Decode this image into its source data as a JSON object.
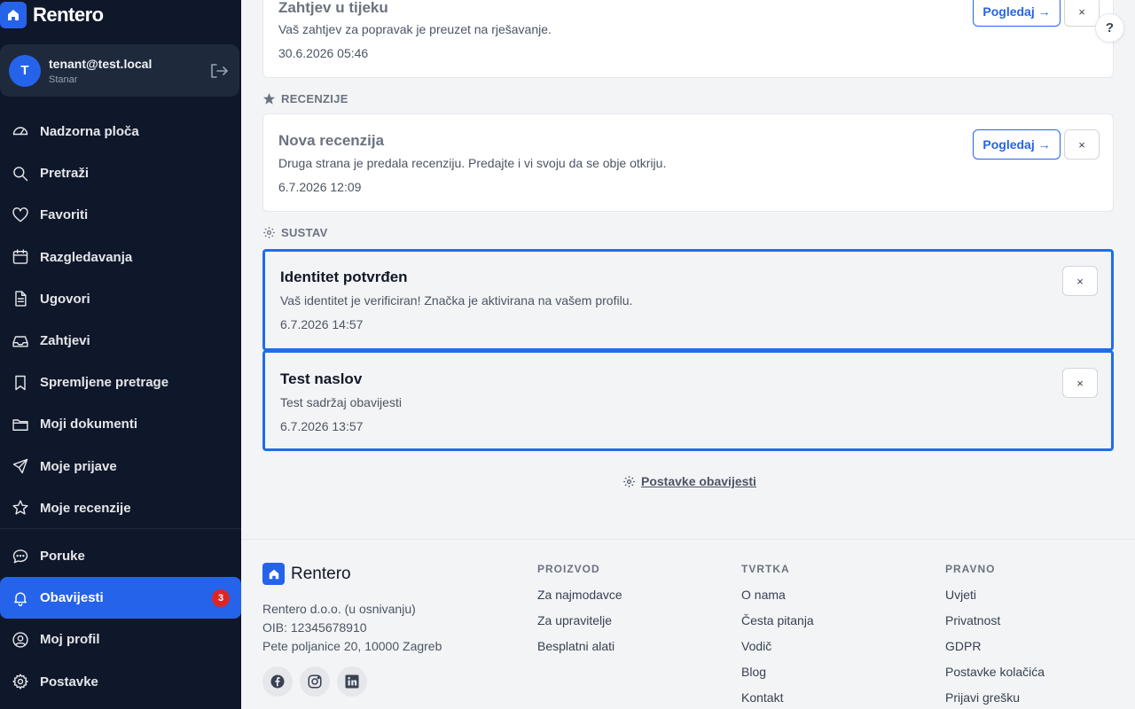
{
  "brand": {
    "name": "Rentero"
  },
  "user": {
    "initial": "T",
    "email": "tenant@test.local",
    "role": "Stanar"
  },
  "nav": [
    {
      "label": "Nadzorna ploča",
      "icon": "dashboard-icon"
    },
    {
      "label": "Pretraži",
      "icon": "search-icon"
    },
    {
      "label": "Favoriti",
      "icon": "heart-icon"
    },
    {
      "label": "Razgledavanja",
      "icon": "calendar-icon"
    },
    {
      "label": "Ugovori",
      "icon": "document-icon"
    },
    {
      "label": "Zahtjevi",
      "icon": "inbox-icon"
    },
    {
      "label": "Spremljene pretrage",
      "icon": "bookmark-icon"
    },
    {
      "label": "Moji dokumenti",
      "icon": "folder-icon"
    },
    {
      "label": "Moje prijave",
      "icon": "send-icon"
    },
    {
      "label": "Moje recenzije",
      "icon": "star-icon"
    }
  ],
  "nav2": [
    {
      "label": "Poruke",
      "icon": "chat-icon"
    },
    {
      "label": "Obavijesti",
      "icon": "bell-icon",
      "badge": "3",
      "active": true
    },
    {
      "label": "Moj profil",
      "icon": "user-circle-icon"
    },
    {
      "label": "Postavke",
      "icon": "gear-icon"
    }
  ],
  "help": "?",
  "notifications": {
    "top_card": {
      "title": "Zahtjev u tijeku",
      "body": "Vaš zahtjev za popravak je preuzet na rješavanje.",
      "time": "30.6.2026 05:46",
      "view": "Pogledaj →",
      "close": "×"
    },
    "reviews_section": "RECENZIJE",
    "review_card": {
      "title": "Nova recenzija",
      "body": "Druga strana je predala recenziju. Predajte i vi svoju da se obje otkriju.",
      "time": "6.7.2026 12:09",
      "view": "Pogledaj →",
      "close": "×"
    },
    "system_section": "SUSTAV",
    "system_cards": [
      {
        "title": "Identitet potvrđen",
        "body": "Vaš identitet je verificiran! Značka je aktivirana na vašem profilu.",
        "time": "6.7.2026 14:57",
        "close": "×"
      },
      {
        "title": "Test naslov",
        "body": "Test sadržaj obavijesti",
        "time": "6.7.2026 13:57",
        "close": "×"
      }
    ],
    "settings_link": "Postavke obavijesti"
  },
  "footer": {
    "brand": "Rentero",
    "company": "Rentero d.o.o. (u osnivanju)",
    "oib": "OIB: 12345678910",
    "address": "Pete poljanice 20, 10000 Zagreb",
    "social": [
      "facebook-icon",
      "instagram-icon",
      "linkedin-icon"
    ],
    "columns": [
      {
        "head": "PROIZVOD",
        "links": [
          "Za najmodavce",
          "Za upravitelje",
          "Besplatni alati"
        ]
      },
      {
        "head": "TVRTKA",
        "links": [
          "O nama",
          "Česta pitanja",
          "Vodič",
          "Blog",
          "Kontakt"
        ]
      },
      {
        "head": "PRAVNO",
        "links": [
          "Uvjeti",
          "Privatnost",
          "GDPR",
          "Postavke kolačića",
          "Prijavi grešku"
        ]
      }
    ]
  },
  "colors": {
    "accent": "#2563eb",
    "sidebar": "#0f172a",
    "badge": "#dc2626"
  }
}
